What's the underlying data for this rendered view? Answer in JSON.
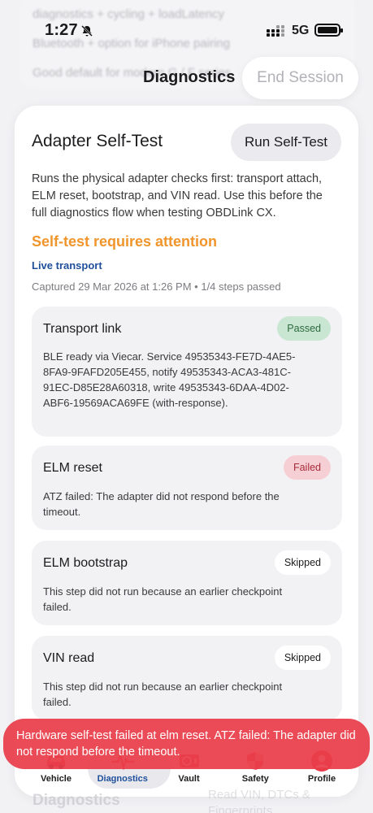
{
  "status": {
    "time": "1:27",
    "network": "5G"
  },
  "background": {
    "line1": "diagnostics + cycling + loadLatency",
    "line2": "Bluetooth + option for iPhone pairing",
    "line3": "Good default for modern G / F series"
  },
  "header": {
    "title": "Diagnostics",
    "end_session_label": "End Session"
  },
  "card": {
    "title": "Adapter Self-Test",
    "run_button": "Run Self-Test",
    "description": "Runs the physical adapter checks first: transport attach, ELM reset, bootstrap, and VIN read. Use this before the full diagnostics flow when testing OBDLink CX.",
    "attention": "Self-test requires attention",
    "transport_label": "Live transport",
    "captured": "Captured 29 Mar 2026 at 1:26 PM • 1/4 steps passed"
  },
  "steps": [
    {
      "title": "Transport link",
      "status": "Passed",
      "desc": "BLE ready via Viecar. Service 49535343-FE7D-4AE5-8FA9-9FAFD205E455, notify 49535343-ACA3-481C-91EC-D85E28A60318, write 49535343-6DAA-4D02-ABF6-19569ACA69FE (with-response)."
    },
    {
      "title": "ELM reset",
      "status": "Failed",
      "desc": "ATZ failed: The adapter did not respond before the timeout."
    },
    {
      "title": "ELM bootstrap",
      "status": "Skipped",
      "desc": "This step did not run because an earlier checkpoint failed."
    },
    {
      "title": "VIN read",
      "status": "Skipped",
      "desc": "This step did not run because an earlier checkpoint failed."
    }
  ],
  "toast": {
    "message": "Hardware self-test failed at elm reset. ATZ failed: The adapter did not respond before the timeout."
  },
  "tabs": [
    {
      "label": "Vehicle",
      "icon": "car-icon"
    },
    {
      "label": "Diagnostics",
      "icon": "pulse-icon"
    },
    {
      "label": "Vault",
      "icon": "vault-icon"
    },
    {
      "label": "Safety",
      "icon": "shield-icon"
    },
    {
      "label": "Profile",
      "icon": "person-icon"
    }
  ],
  "ghost": {
    "left": "Diagnostics",
    "right": "Read VIN, DTCs & Fingerprints"
  },
  "colors": {
    "accent": "#1e4f9a",
    "warning": "#f0952c",
    "error": "#e83d49",
    "passed": "#c9e6d2",
    "failed": "#f6cfd4"
  }
}
